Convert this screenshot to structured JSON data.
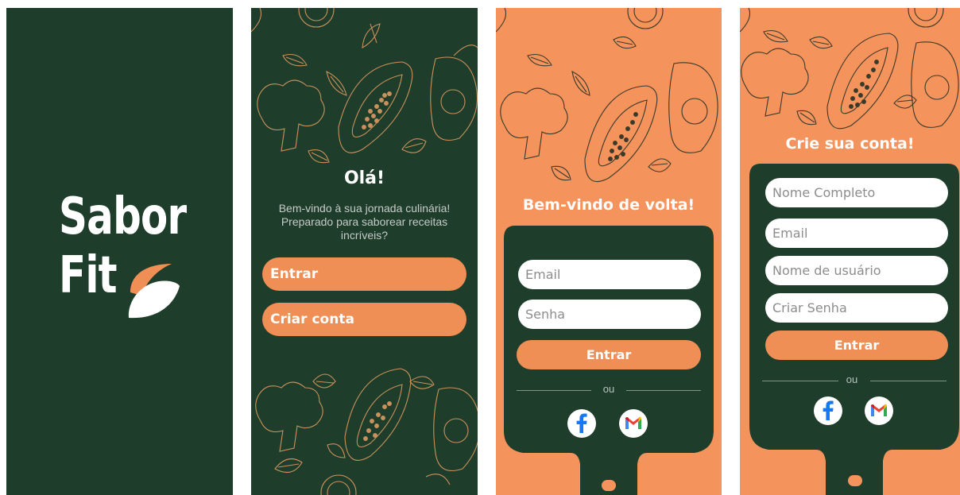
{
  "splash": {
    "logo_line1": "Sabor",
    "logo_line2": "Fit",
    "logo_icon": "leaf-icon"
  },
  "welcome": {
    "title": "Olá!",
    "message": "Bem-vindo à sua jornada culinária! Preparado para saborear receitas incríveis?",
    "login_button": "Entrar",
    "signup_button": "Criar conta"
  },
  "login": {
    "title": "Bem-vindo de volta!",
    "email_placeholder": "Email",
    "password_placeholder": "Senha",
    "submit": "Entrar",
    "or": "ou",
    "social": [
      "facebook-icon",
      "gmail-icon"
    ]
  },
  "signup": {
    "title": "Crie sua conta!",
    "fullname_placeholder": "Nome Completo",
    "email_placeholder": "Email",
    "username_placeholder": "Nome de usuário",
    "password_placeholder": "Criar Senha",
    "submit": "Entrar",
    "or": "ou",
    "social": [
      "facebook-icon",
      "gmail-icon"
    ]
  },
  "colors": {
    "dark_green": "#1f3d2b",
    "orange": "#f4935c",
    "button_orange": "#ef8e55",
    "white": "#ffffff"
  }
}
